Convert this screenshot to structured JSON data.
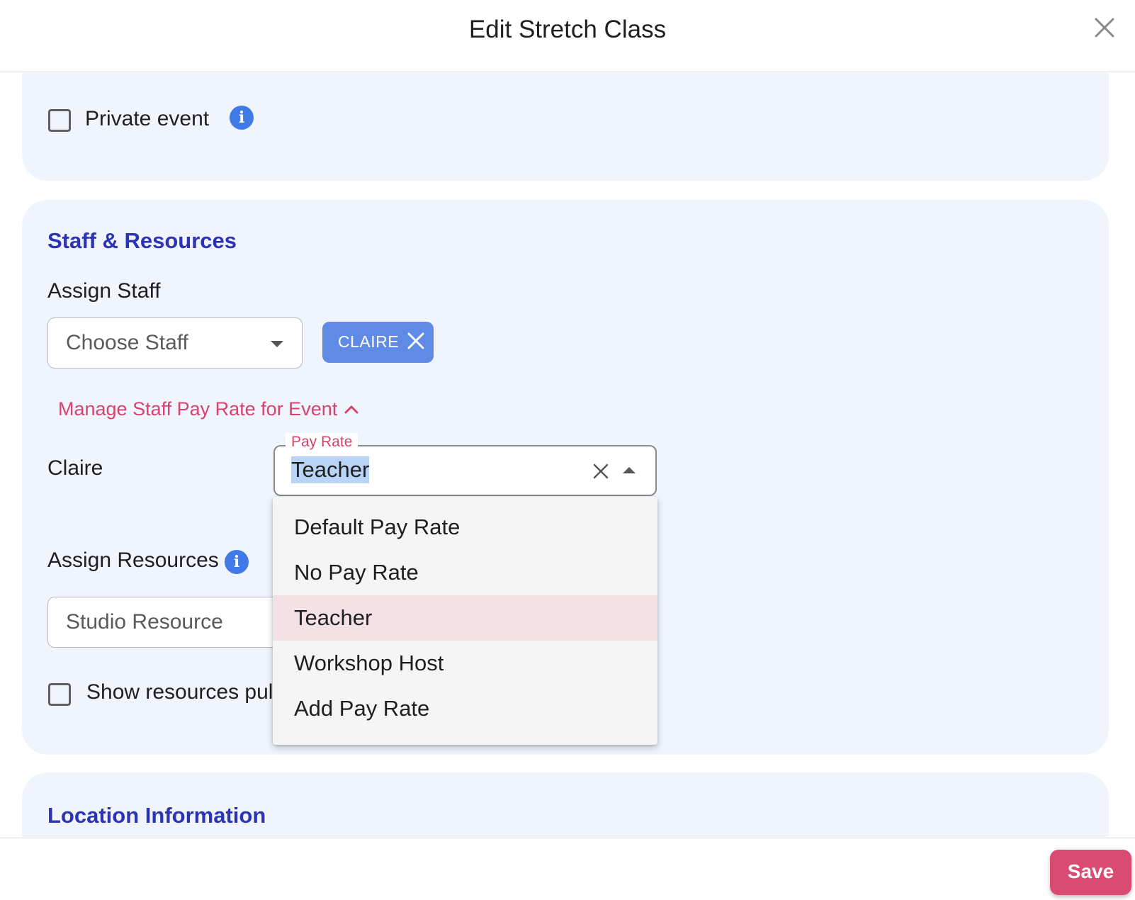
{
  "modal": {
    "title": "Edit Stretch Class",
    "close_icon": "close-icon"
  },
  "private_event": {
    "label": "Private event",
    "checked": false,
    "info_icon": "info-icon"
  },
  "staff_resources": {
    "section_title": "Staff & Resources",
    "assign_staff_label": "Assign Staff",
    "choose_staff_placeholder": "Choose Staff",
    "selected_staff_chip": "CLAIRE",
    "manage_pay_rate_link": "Manage Staff Pay Rate for Event",
    "pay_rate_row": {
      "staff_name": "Claire",
      "field_label": "Pay Rate",
      "value": "Teacher"
    },
    "pay_rate_options": [
      "Default Pay Rate",
      "No Pay Rate",
      "Teacher",
      "Workshop Host",
      "Add Pay Rate"
    ],
    "pay_rate_highlighted": "Teacher",
    "assign_resources_label": "Assign Resources",
    "resource_placeholder": "Studio Resource",
    "show_resources_label": "Show resources pul",
    "show_resources_checked": false
  },
  "location": {
    "section_title": "Location Information"
  },
  "footer": {
    "save_label": "Save"
  },
  "colors": {
    "accent_blue": "#2a34b5",
    "chip_blue": "#5f8ae6",
    "pink": "#d6446e",
    "save_button": "#d94b73",
    "card_bg": "#f0f4fd"
  }
}
